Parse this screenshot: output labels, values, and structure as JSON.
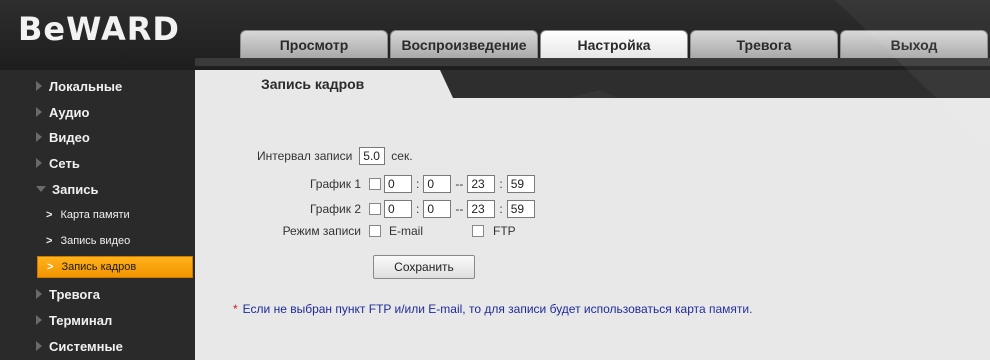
{
  "brand": {
    "logo_text": "BeWARD"
  },
  "top_tabs": [
    {
      "label": "Просмотр",
      "active": false
    },
    {
      "label": "Воспроизведение",
      "active": false
    },
    {
      "label": "Настройка",
      "active": true
    },
    {
      "label": "Тревога",
      "active": false
    },
    {
      "label": "Выход",
      "active": false
    }
  ],
  "sidebar": {
    "items": [
      {
        "label": "Локальные"
      },
      {
        "label": "Аудио"
      },
      {
        "label": "Видео"
      },
      {
        "label": "Сеть"
      },
      {
        "label": "Запись",
        "expanded": true
      },
      {
        "label": "Тревога"
      },
      {
        "label": "Терминал"
      },
      {
        "label": "Системные"
      }
    ],
    "subitems": [
      {
        "label": "Карта памяти",
        "active": false
      },
      {
        "label": "Запись видео",
        "active": false
      },
      {
        "label": "Запись кадров",
        "active": true
      }
    ]
  },
  "content": {
    "tab_title": "Запись кадров",
    "interval": {
      "label": "Интервал записи",
      "value": "5.0",
      "unit": "сек."
    },
    "schedule1": {
      "label": "График 1",
      "h1": "0",
      "m1": "0",
      "h2": "23",
      "m2": "59",
      "checked": false
    },
    "schedule2": {
      "label": "График 2",
      "h1": "0",
      "m1": "0",
      "h2": "23",
      "m2": "59",
      "checked": false
    },
    "mode": {
      "label": "Режим записи",
      "email_label": "E-mail",
      "ftp_label": "FTP"
    },
    "colon": ":",
    "dash": "--",
    "save_label": "Сохранить",
    "note_star": "*",
    "note": "Если не выбран пункт FTP и/или E-mail, то для записи будет использоваться карта памяти."
  },
  "colors": {
    "accent_orange": "#f39400",
    "note_blue": "#1e2a9a",
    "star_red": "#d01a1a"
  }
}
